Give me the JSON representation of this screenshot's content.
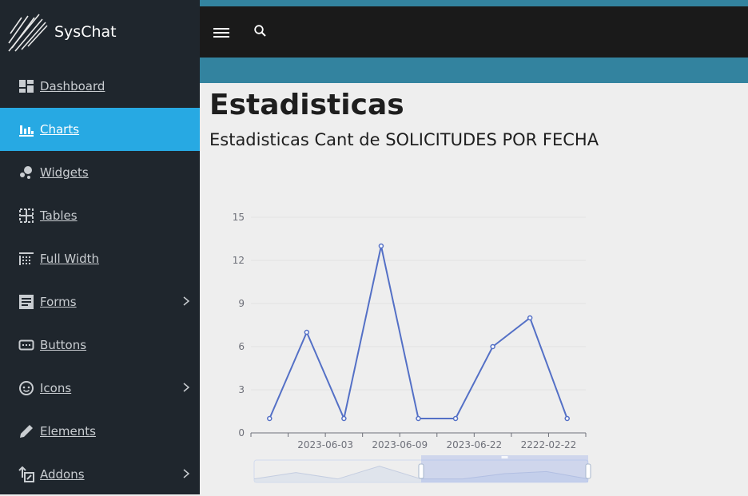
{
  "brand": {
    "name": "SysChat"
  },
  "sidebar": {
    "items": [
      {
        "label": "Dashboard",
        "icon": "dashboard-icon",
        "active": false,
        "has_submenu": false
      },
      {
        "label": "Charts",
        "icon": "bar-chart-icon",
        "active": true,
        "has_submenu": false
      },
      {
        "label": "Widgets",
        "icon": "bubbles-icon",
        "active": false,
        "has_submenu": false
      },
      {
        "label": "Tables",
        "icon": "table-icon",
        "active": false,
        "has_submenu": false
      },
      {
        "label": "Full Width",
        "icon": "grid-icon",
        "active": false,
        "has_submenu": false
      },
      {
        "label": "Forms",
        "icon": "form-icon",
        "active": false,
        "has_submenu": true
      },
      {
        "label": "Buttons",
        "icon": "button-icon",
        "active": false,
        "has_submenu": false
      },
      {
        "label": "Icons",
        "icon": "face-icon",
        "active": false,
        "has_submenu": true
      },
      {
        "label": "Elements",
        "icon": "pencil-icon",
        "active": false,
        "has_submenu": false
      },
      {
        "label": "Addons",
        "icon": "addons-icon",
        "active": false,
        "has_submenu": true
      }
    ]
  },
  "colors": {
    "sidebar_bg": "#1f262d",
    "active_bg": "#27a9e3",
    "topbar_bg": "#1a1a1a",
    "accent": "#33839f",
    "series": "#5470c6"
  },
  "page": {
    "title": "Estadisticas",
    "chart_title": "Estadisticas Cant de SOLICITUDES POR FECHA"
  },
  "chart_data": {
    "type": "line",
    "title": "Estadisticas Cant de SOLICITUDES POR FECHA",
    "xlabel": "",
    "ylabel": "",
    "ylim": [
      0,
      15
    ],
    "yticks": [
      0,
      3,
      6,
      9,
      12,
      15
    ],
    "x_tick_labels": [
      "2023-06-03",
      "2023-06-09",
      "2023-06-22",
      "2222-02-22"
    ],
    "series": [
      {
        "values": [
          1,
          7,
          1,
          13,
          1,
          1,
          6,
          8,
          1
        ]
      }
    ],
    "grid": true,
    "data_zoom": {
      "start": 0.5,
      "end": 1.0
    }
  }
}
